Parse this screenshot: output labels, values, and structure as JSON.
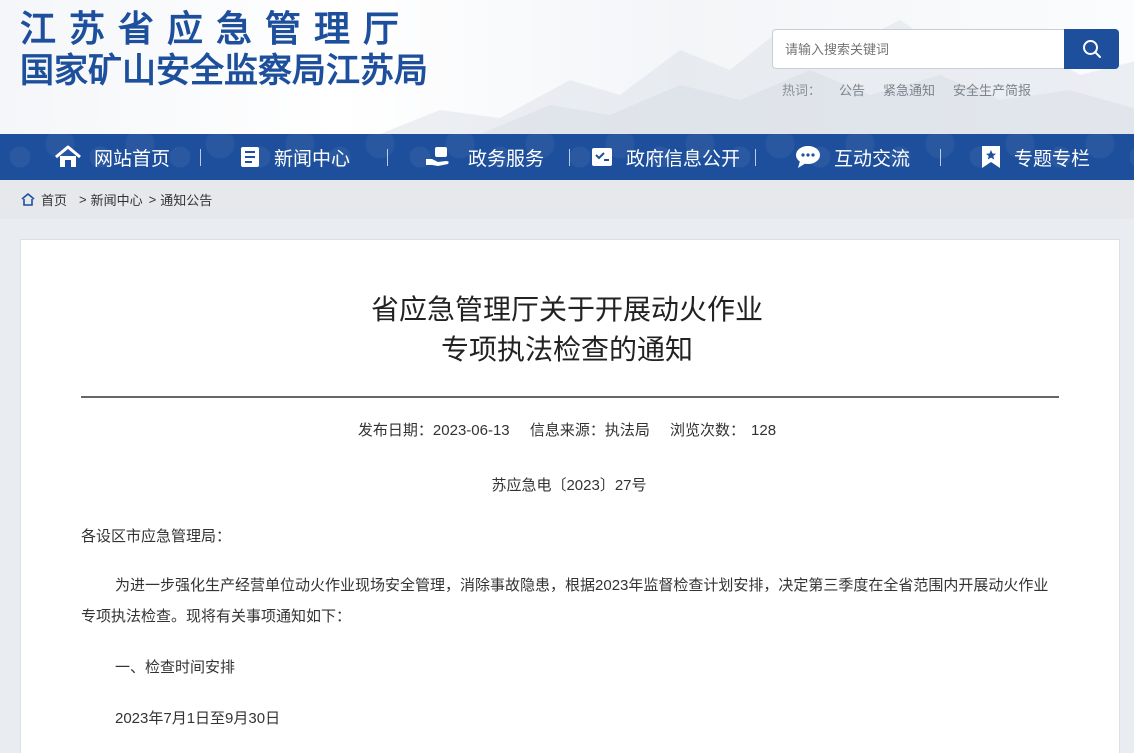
{
  "header": {
    "title_line1": "江苏省应急管理厅",
    "title_line2": "国家矿山安全监察局江苏局",
    "search": {
      "placeholder": "请输入搜索关键词"
    },
    "hotwords_label": "热词：",
    "hotwords": [
      "公告",
      "紧急通知",
      "安全生产简报"
    ]
  },
  "nav": {
    "items": [
      {
        "label": "网站首页",
        "icon": "home-icon"
      },
      {
        "label": "新闻中心",
        "icon": "news-icon"
      },
      {
        "label": "政务服务",
        "icon": "service-hand-icon"
      },
      {
        "label": "政府信息公开",
        "icon": "info-disclosure-icon"
      },
      {
        "label": "互动交流",
        "icon": "chat-icon"
      },
      {
        "label": "专题专栏",
        "icon": "bookmark-star-icon"
      }
    ]
  },
  "breadcrumb": {
    "icon": "home-icon",
    "items": [
      "首页",
      "新闻中心",
      "通知公告"
    ],
    "separator": ">"
  },
  "article": {
    "title_line1": "省应急管理厅关于开展动火作业",
    "title_line2": "专项执法检查的通知",
    "publish_label": "发布日期：",
    "publish_date": "2023-06-13",
    "source_label": "信息来源：",
    "source": "执法局",
    "views_label": "浏览次数：",
    "views": "128",
    "doc_number": "苏应急电〔2023〕27号",
    "salutation": "各设区市应急管理局：",
    "body_p1": "为进一步强化生产经营单位动火作业现场安全管理，消除事故隐患，根据2023年监督检查计划安排，决定第三季度在全省范围内开展动火作业专项执法检查。现将有关事项通知如下：",
    "section1": "一、检查时间安排",
    "section1_text": "2023年7月1日至9月30日"
  },
  "colors": {
    "brand_blue": "#1d4f9c",
    "breadcrumb_bg": "#e6e8ec"
  }
}
